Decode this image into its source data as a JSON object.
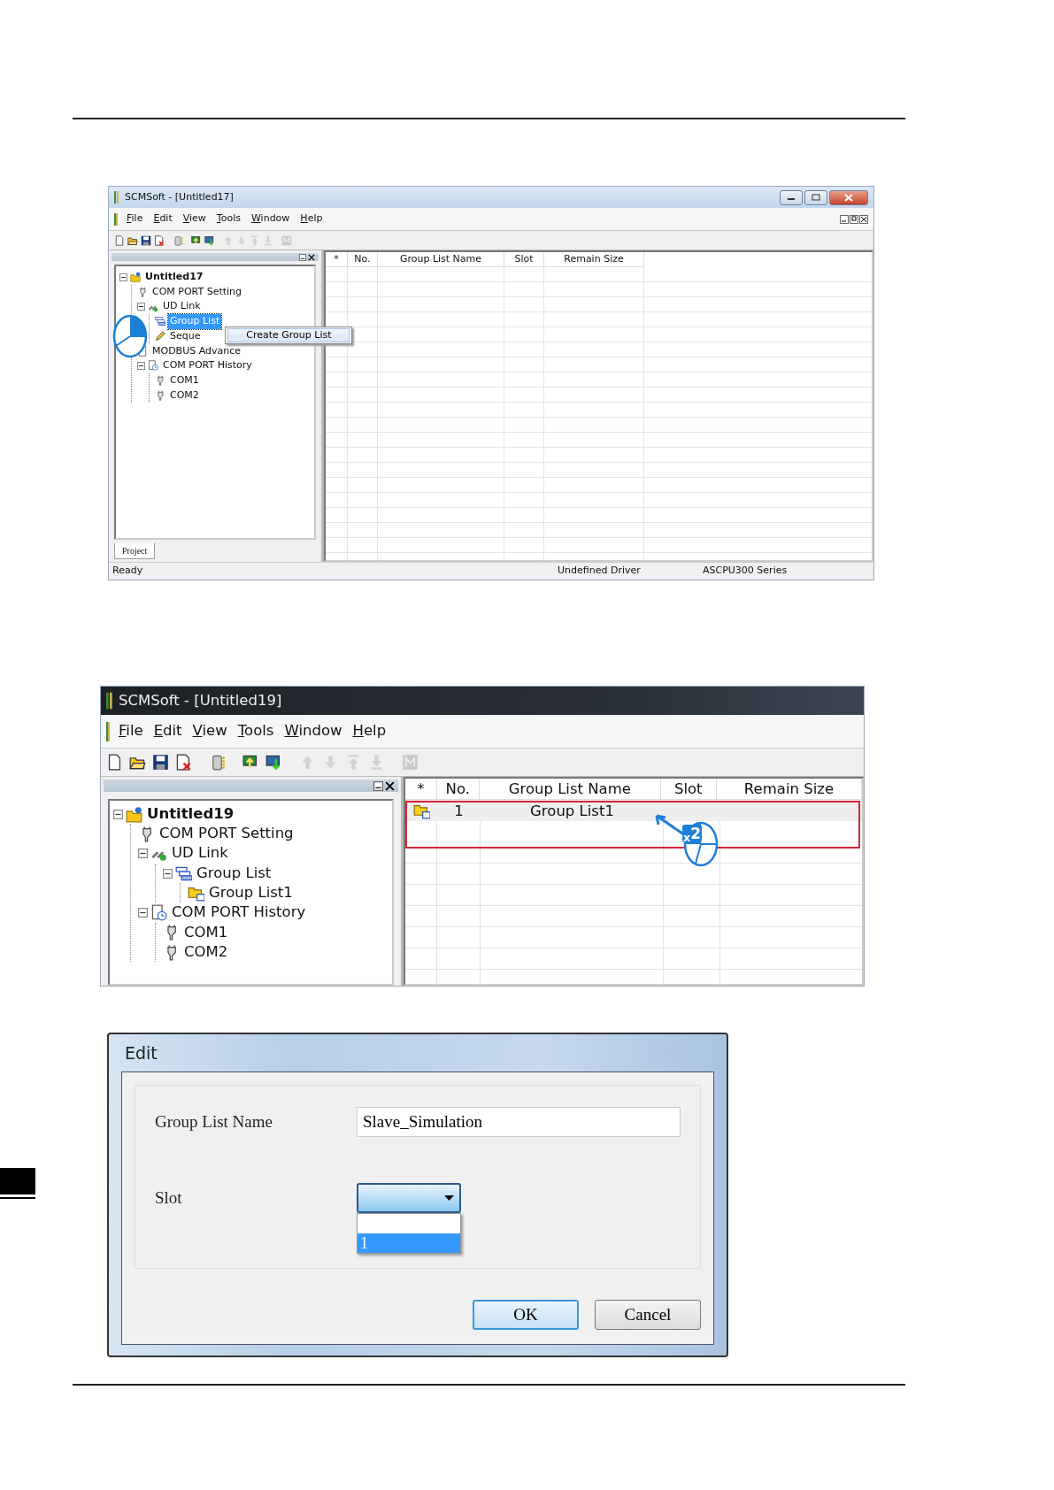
{
  "screens": [
    {
      "title": "SCMSoft - [Untitled17]",
      "dark_title": false,
      "window_controls": true,
      "menu": [
        "File",
        "Edit",
        "View",
        "Tools",
        "Window",
        "Help"
      ],
      "toolbar": [
        {
          "disabled": false
        },
        {
          "disabled": false
        },
        {
          "disabled": false
        },
        {
          "disabled": false
        },
        {
          "disabled": false
        },
        {
          "disabled": false
        },
        {
          "disabled": false
        },
        {
          "disabled": true
        },
        {
          "disabled": true
        },
        {
          "disabled": true
        },
        {
          "disabled": true
        },
        {
          "disabled": true
        }
      ],
      "tree": [
        {
          "label": "Untitled17",
          "kind": "project",
          "expanded": true,
          "selected": false,
          "children": [
            {
              "label": "COM PORT Setting",
              "kind": "port",
              "selected": false
            },
            {
              "label": "UD Link",
              "kind": "link",
              "expanded": true,
              "selected": false,
              "children": [
                {
                  "label": "Group List",
                  "kind": "group",
                  "selected": true
                },
                {
                  "label": "Seque",
                  "kind": "sequence",
                  "selected": false
                }
              ]
            },
            {
              "label": "MODBUS Advance",
              "kind": "modbus",
              "selected": false
            },
            {
              "label": "COM PORT History",
              "kind": "history",
              "expanded": true,
              "selected": false,
              "children": [
                {
                  "label": "COM1",
                  "kind": "port",
                  "selected": false
                },
                {
                  "label": "COM2",
                  "kind": "port",
                  "selected": false
                }
              ]
            }
          ]
        }
      ],
      "columns": [
        "*",
        "No.",
        "Group List Name",
        "Slot",
        "Remain Size"
      ],
      "context_menu": [
        "Create Group List"
      ],
      "panel_tabs": [
        "Project"
      ],
      "status": [
        "Ready",
        "Undefined Driver",
        "ASCPU300 Series"
      ],
      "marker": {
        "kind": "pie"
      }
    },
    {
      "title": "SCMSoft - [Untitled19]",
      "dark_title": true,
      "window_controls": false,
      "menu": [
        "File",
        "Edit",
        "View",
        "Tools",
        "Window",
        "Help"
      ],
      "toolbar": [
        {
          "disabled": false
        },
        {
          "disabled": false
        },
        {
          "disabled": false
        },
        {
          "disabled": false
        },
        {
          "disabled": false
        },
        {
          "disabled": false
        },
        {
          "disabled": false
        },
        {
          "disabled": true
        },
        {
          "disabled": true
        },
        {
          "disabled": true
        },
        {
          "disabled": true
        },
        {
          "disabled": true
        }
      ],
      "tree": [
        {
          "label": "Untitled19",
          "kind": "project",
          "expanded": true,
          "selected": false,
          "children": [
            {
              "label": "COM PORT Setting",
              "kind": "port",
              "selected": false
            },
            {
              "label": "UD Link",
              "kind": "link",
              "expanded": true,
              "selected": false,
              "children": [
                {
                  "label": "Group List",
                  "kind": "group",
                  "expanded": true,
                  "selected": false,
                  "children": [
                    {
                      "label": "Group List1",
                      "kind": "item",
                      "selected": false
                    }
                  ]
                }
              ]
            },
            {
              "label": "COM PORT History",
              "kind": "history",
              "expanded": true,
              "selected": false,
              "children": [
                {
                  "label": "COM1",
                  "kind": "port",
                  "selected": false
                },
                {
                  "label": "COM2",
                  "kind": "port",
                  "selected": false
                }
              ]
            }
          ]
        }
      ],
      "columns": [
        "*",
        "No.",
        "Group List Name",
        "Slot",
        "Remain Size"
      ],
      "rows": [
        {
          "kind": "item",
          "no": "1",
          "name": "Group List1",
          "highlighted": true
        }
      ],
      "marker": {
        "kind": "count",
        "label": "$_{x}$2"
      }
    }
  ],
  "dialog": {
    "title": "Edit",
    "fields": [
      {
        "kind": "text",
        "label": "Group List Name",
        "value": "Slave_Simulation"
      },
      {
        "kind": "dropdown",
        "label": "Slot",
        "expanded": true,
        "options": [
          {
            "label": "1",
            "selected": true
          }
        ]
      }
    ],
    "buttons": [
      {
        "label": "OK",
        "default": true
      },
      {
        "label": "Cancel",
        "default": false
      }
    ]
  }
}
